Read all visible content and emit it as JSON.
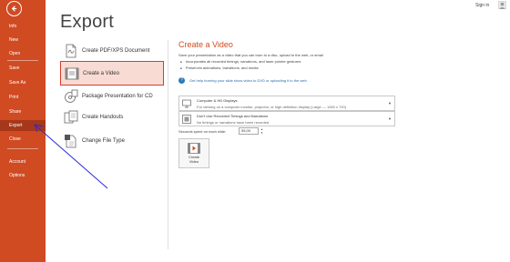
{
  "header": {
    "title": "Export",
    "signin": "Sign in"
  },
  "sidebar": {
    "items": [
      {
        "label": "Info"
      },
      {
        "label": "New"
      },
      {
        "label": "Open"
      },
      {
        "label": "Save"
      },
      {
        "label": "Save As"
      },
      {
        "label": "Print"
      },
      {
        "label": "Share"
      },
      {
        "label": "Export"
      },
      {
        "label": "Close"
      },
      {
        "label": "Account"
      },
      {
        "label": "Options"
      }
    ],
    "active": "Export"
  },
  "export_options": [
    {
      "label": "Create PDF/XPS Document",
      "icon": "pdf-document-icon"
    },
    {
      "label": "Create a Video",
      "icon": "video-icon",
      "selected": true
    },
    {
      "label": "Package Presentation for CD",
      "icon": "package-cd-icon"
    },
    {
      "label": "Create Handouts",
      "icon": "handouts-icon"
    },
    {
      "label": "Change File Type",
      "icon": "file-type-icon"
    }
  ],
  "panel": {
    "title": "Create a Video",
    "description": "Save your presentation as a video that you can burn to a disc, upload to the web, or email",
    "bullets": [
      "Incorporates all recorded timings, narrations, and laser pointer gestures",
      "Preserves animations, transitions, and media"
    ],
    "help_link": "Get help burning your slide show video to DVD or uploading it to the web",
    "quality_dropdown": {
      "title": "Computer & HD Displays",
      "subtitle": "For viewing on a computer monitor, projector, or high definition display  (Large — 1280 x 720)"
    },
    "timings_dropdown": {
      "title": "Don't Use Recorded Timings and Narrations",
      "subtitle": "No timings or narrations have been recorded"
    },
    "seconds_label": "Seconds spent on each slide:",
    "seconds_value": "05,00",
    "create_button": "Create\nVideo"
  },
  "colors": {
    "accent": "#d04a22",
    "selected_bg": "#f8dcd3",
    "highlight_border": "#d63c2e",
    "annotation": "#2a2ad8"
  }
}
